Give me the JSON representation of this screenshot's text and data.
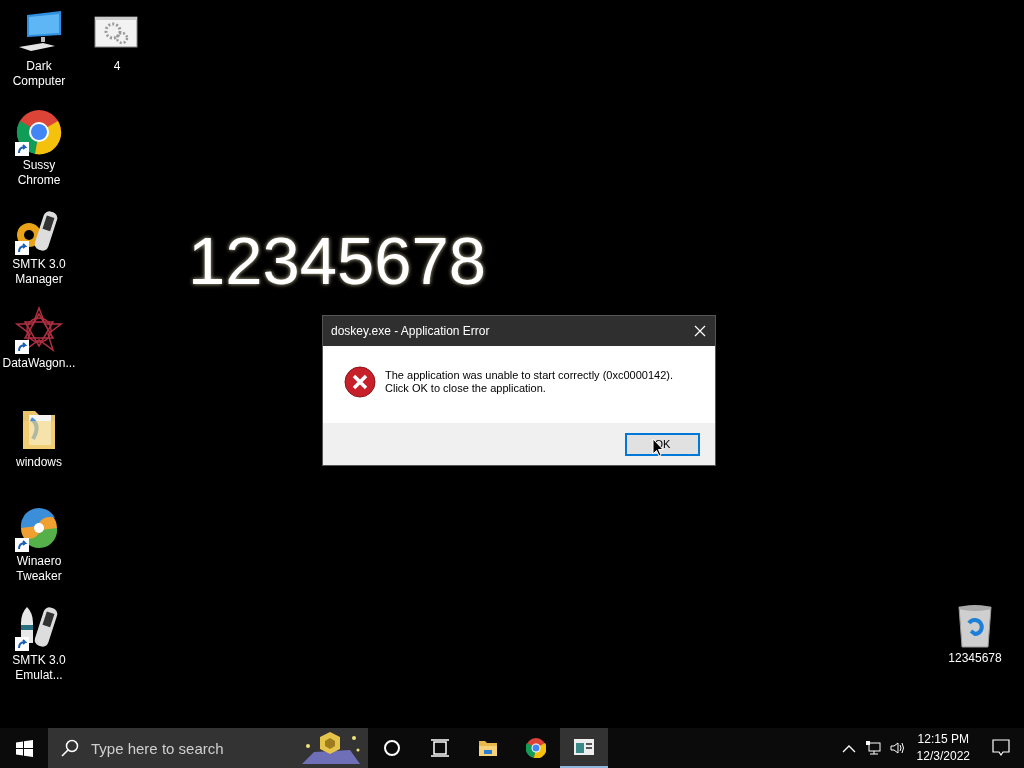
{
  "desktop": {
    "left_column": [
      {
        "label": "Dark Computer",
        "kind": "computer",
        "shortcut": false
      },
      {
        "label": "Sussy Chrome",
        "kind": "chrome",
        "shortcut": true
      },
      {
        "label": "SMTK 3.0 Manager",
        "kind": "gear-phone",
        "shortcut": true
      },
      {
        "label": "DataWagon...",
        "kind": "star",
        "shortcut": true
      },
      {
        "label": "windows",
        "kind": "folder",
        "shortcut": false
      },
      {
        "label": "Winaero Tweaker",
        "kind": "swirl",
        "shortcut": true
      },
      {
        "label": "SMTK 3.0 Emulat...",
        "kind": "rocket-phone",
        "shortcut": true
      }
    ],
    "second_column": [
      {
        "label": "4",
        "kind": "settings-window",
        "shortcut": false
      }
    ],
    "right_column": [
      {
        "label": "12345678",
        "kind": "recycle-bin",
        "shortcut": false
      }
    ],
    "overlay_text": "12345678"
  },
  "dialog": {
    "title": "doskey.exe - Application Error",
    "message_lines": [
      "The application was unable to start correctly (0xc0000142).",
      "Click OK to close the application."
    ],
    "buttons": [
      {
        "label": "OK",
        "focused": true
      }
    ]
  },
  "taskbar": {
    "search": {
      "placeholder": "Type here to search"
    },
    "apps": [
      {
        "kind": "cortana",
        "active": false
      },
      {
        "kind": "task-view",
        "active": false
      },
      {
        "kind": "explorer",
        "active": false
      },
      {
        "kind": "chrome",
        "active": false
      },
      {
        "kind": "window-app",
        "active": true
      }
    ],
    "clock": {
      "time": "12:15 PM",
      "date": "12/3/2022"
    }
  }
}
